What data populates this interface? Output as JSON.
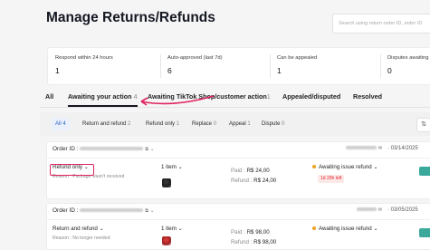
{
  "page": {
    "title": "Manage Returns/Refunds",
    "search_placeholder": "Search using return order ID, order ID"
  },
  "stats": [
    {
      "label": "Respond within 24 hours",
      "value": "1"
    },
    {
      "label": "Auto-approved (last 7d)",
      "value": "6"
    },
    {
      "label": "Can be appealed",
      "value": "1"
    },
    {
      "label": "Disputes awaiting",
      "value": "0"
    }
  ],
  "tabs": [
    {
      "label": "All",
      "count": ""
    },
    {
      "label": "Awaiting your action",
      "count": "4"
    },
    {
      "label": "Awaiting TikTok Shop/customer action",
      "count": "1"
    },
    {
      "label": "Appealed/disputed",
      "count": ""
    },
    {
      "label": "Resolved",
      "count": ""
    }
  ],
  "filters": [
    {
      "label": "All",
      "count": "4"
    },
    {
      "label": "Return and refund",
      "count": "2"
    },
    {
      "label": "Refund only",
      "count": "1"
    },
    {
      "label": "Replace",
      "count": "0"
    },
    {
      "label": "Appeal",
      "count": "1"
    },
    {
      "label": "Dispute",
      "count": "0"
    }
  ],
  "sort_icon": "sort-icon",
  "orders": [
    {
      "order_label": "Order ID :",
      "date": "03/14/2025",
      "return_type": "Refund only",
      "reason": "Reason : Package wasn't received",
      "items": "1 item",
      "paid_label": "Paid :",
      "paid_value": "R$ 24,00",
      "refund_label": "Refund :",
      "refund_value": "R$ 24,00",
      "status": "Awaiting issue refund",
      "time_left": "1d 20h left"
    },
    {
      "order_label": "Order ID :",
      "date": "03/05/2025",
      "return_type": "Return and refund",
      "reason": "Reason : No longer needed",
      "items": "1 item",
      "paid_label": "Paid :",
      "paid_value": "R$ 98,00",
      "refund_label": "Refund :",
      "refund_value": "R$ 98,00",
      "status": "Awaiting issue refund",
      "time_left": ""
    }
  ],
  "colors": {
    "accent_blue": "#2b5fc4",
    "highlight": "#e0245e",
    "status_dot": "#f0a020",
    "action_button": "#3aa99c"
  }
}
